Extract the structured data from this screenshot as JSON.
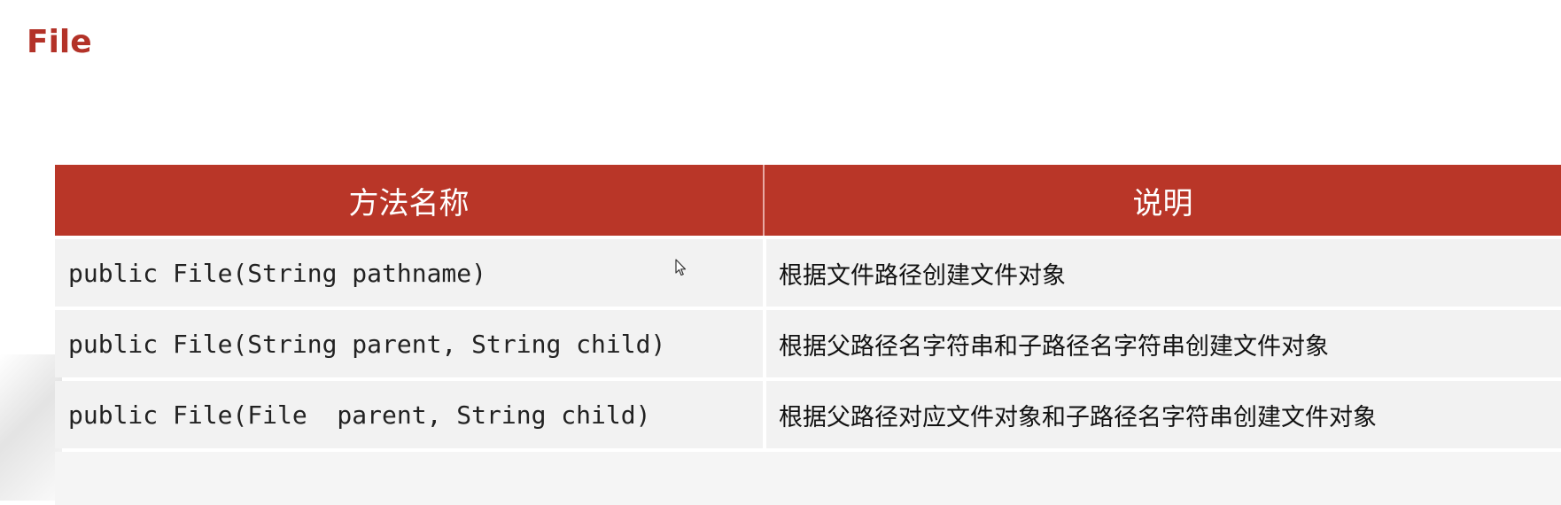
{
  "title": "File",
  "table": {
    "headers": [
      "方法名称",
      "说明"
    ],
    "rows": [
      {
        "method": "public File(String pathname)",
        "desc": "根据文件路径创建文件对象"
      },
      {
        "method": "public File(String parent, String child)",
        "desc": "根据父路径名字符串和子路径名字符串创建文件对象"
      },
      {
        "method": "public File(File  parent, String child)",
        "desc": "根据父路径对应文件对象和子路径名字符串创建文件对象"
      }
    ]
  },
  "colors": {
    "title": "#b33228",
    "header_bg": "#b93628",
    "row_bg": "#f2f2f2"
  },
  "icons": {
    "cursor": "mouse-pointer-icon"
  }
}
